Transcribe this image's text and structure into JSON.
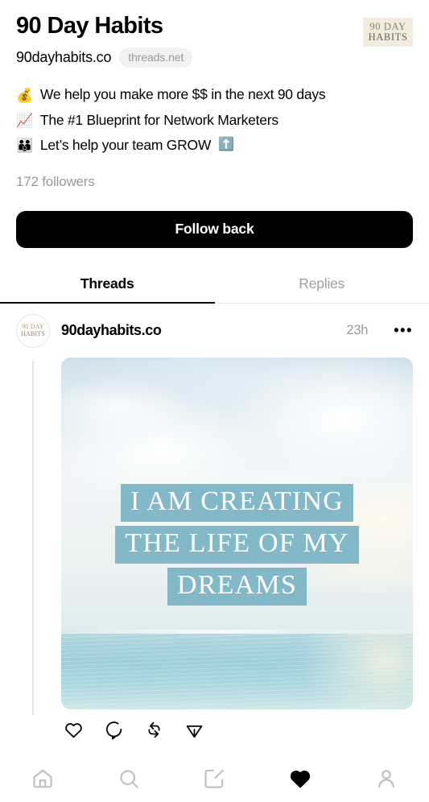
{
  "profile": {
    "display_name": "90 Day Habits",
    "handle": "90dayhabits.co",
    "domain_badge": "threads.net",
    "brand_avatar": {
      "line1": "90 DAY",
      "line2": "HABITS"
    },
    "bio": [
      {
        "emoji": "💰",
        "emoji_name": "money-bag-emoji",
        "text": "We help you make more $$ in the next 90 days"
      },
      {
        "emoji": "📈",
        "emoji_name": "chart-increasing-emoji",
        "text": "The #1 Blueprint for Network Marketers"
      },
      {
        "emoji": "👪",
        "emoji_name": "family-emoji",
        "text": "Let’s help your team GROW ",
        "trailing_emoji": "⬆️",
        "trailing_emoji_name": "up-arrow-emoji"
      }
    ],
    "followers": "172 followers",
    "follow_button": "Follow back"
  },
  "tabs": [
    {
      "label": "Threads",
      "active": true
    },
    {
      "label": "Replies",
      "active": false
    }
  ],
  "post": {
    "avatar": {
      "line1": "90 DAY",
      "line2": "HABITS"
    },
    "username": "90dayhabits.co",
    "timestamp": "23h",
    "more_menu": "•••",
    "image": {
      "quote_lines": [
        "I AM CREATING",
        "THE LIFE OF MY",
        "DREAMS"
      ],
      "highlight_color": "#83b8c9",
      "text_color": "#ffffff",
      "scene": "sky and ocean horizon"
    },
    "actions": [
      {
        "name": "like-button",
        "icon": "heart-icon"
      },
      {
        "name": "reply-button",
        "icon": "comment-icon"
      },
      {
        "name": "repost-button",
        "icon": "repost-icon"
      },
      {
        "name": "share-button",
        "icon": "share-icon"
      }
    ]
  },
  "bottom_nav": [
    {
      "name": "nav-home",
      "icon": "home-icon",
      "active": false
    },
    {
      "name": "nav-search",
      "icon": "search-icon",
      "active": false
    },
    {
      "name": "nav-compose",
      "icon": "compose-icon",
      "active": false
    },
    {
      "name": "nav-activity",
      "icon": "heart-filled-icon",
      "active": true
    },
    {
      "name": "nav-profile",
      "icon": "person-icon",
      "active": false
    }
  ],
  "colors": {
    "text_primary": "#000000",
    "text_muted": "#999999",
    "accent_button": "#000000",
    "nav_inactive": "#c2c2c2",
    "nav_active": "#000000"
  }
}
